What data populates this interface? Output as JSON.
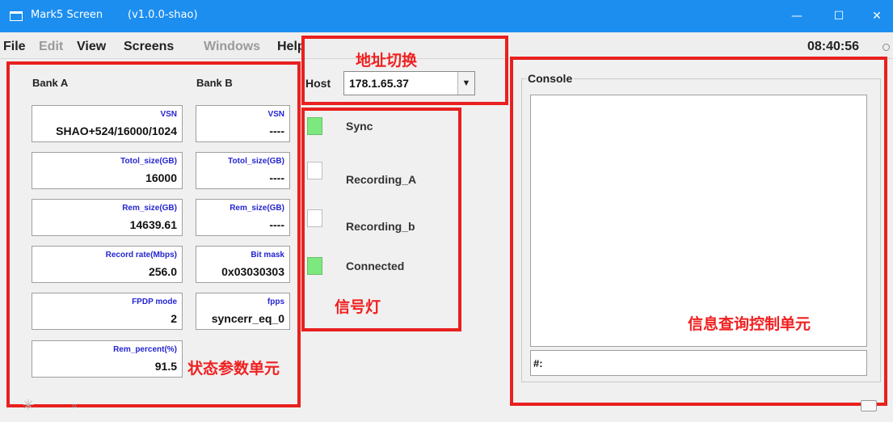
{
  "window": {
    "title": "Mark5 Screen",
    "version": "(v1.0.0-shao)",
    "minimize": "—",
    "maximize": "☐",
    "close": "✕"
  },
  "menubar": {
    "items": [
      {
        "label": "File",
        "enabled": true
      },
      {
        "label": "Edit",
        "enabled": false
      },
      {
        "label": "View",
        "enabled": true
      },
      {
        "label": "Screens",
        "enabled": true
      },
      {
        "label": "Windows",
        "enabled": false
      },
      {
        "label": "Help",
        "enabled": true
      }
    ],
    "clock": "08:40:56"
  },
  "bank_a": {
    "header": "Bank A",
    "fields": [
      {
        "label": "VSN",
        "value": "SHAO+524/16000/1024"
      },
      {
        "label": "Totol_size(GB)",
        "value": "16000"
      },
      {
        "label": "Rem_size(GB)",
        "value": "14639.61"
      },
      {
        "label": "Record rate(Mbps)",
        "value": "256.0"
      },
      {
        "label": "FPDP mode",
        "value": "2"
      },
      {
        "label": "Rem_percent(%)",
        "value": "91.5"
      }
    ]
  },
  "bank_b": {
    "header": "Bank B",
    "fields": [
      {
        "label": "VSN",
        "value": "----"
      },
      {
        "label": "Totol_size(GB)",
        "value": "----"
      },
      {
        "label": "Rem_size(GB)",
        "value": "----"
      },
      {
        "label": "Bit mask",
        "value": "0x03030303"
      },
      {
        "label": "fpps",
        "value": "syncerr_eq_0"
      }
    ]
  },
  "host": {
    "label": "Host",
    "value": "178.1.65.37"
  },
  "leds": [
    {
      "label": "Sync",
      "on": true
    },
    {
      "label": "Recording_A",
      "on": false
    },
    {
      "label": "Recording_b",
      "on": false
    },
    {
      "label": "Connected",
      "on": true
    }
  ],
  "console": {
    "title": "Console",
    "prompt": "#:"
  },
  "annotations": {
    "status_params": "状态参数单元",
    "address_switch": "地址切换",
    "signal_lights": "信号灯",
    "info_query": "信息查询控制单元"
  },
  "colors": {
    "titlebar": "#1c8ef0",
    "annotation": "#e8201f",
    "led_on": "#7de87d",
    "field_label": "#2525d0"
  }
}
